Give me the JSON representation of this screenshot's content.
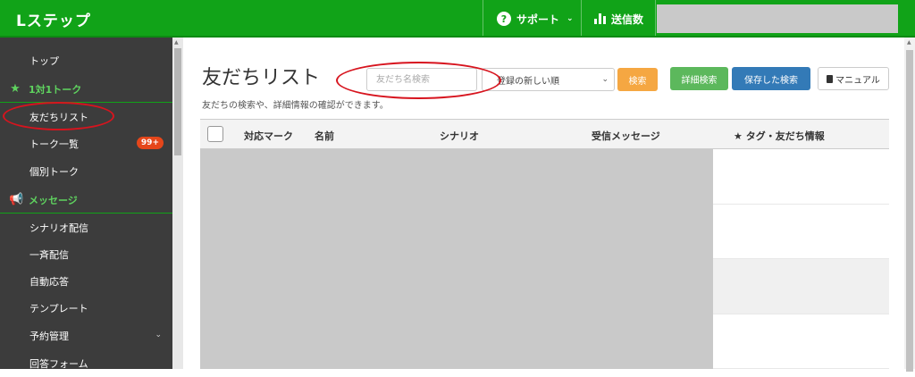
{
  "header": {
    "brand": "Lステップ",
    "support_label": "サポート",
    "sendcount_label": "送信数"
  },
  "sidebar": {
    "items": [
      {
        "label": "トップ",
        "type": "item"
      },
      {
        "label": "1対1トーク",
        "type": "section",
        "icon": "star-icon"
      },
      {
        "label": "友だちリスト",
        "type": "item",
        "annotated": true
      },
      {
        "label": "トーク一覧",
        "type": "item",
        "badge": "99+"
      },
      {
        "label": "個別トーク",
        "type": "item"
      },
      {
        "label": "メッセージ",
        "type": "section",
        "icon": "megaphone-icon"
      },
      {
        "label": "シナリオ配信",
        "type": "item"
      },
      {
        "label": "一斉配信",
        "type": "item"
      },
      {
        "label": "自動応答",
        "type": "item"
      },
      {
        "label": "テンプレート",
        "type": "item"
      },
      {
        "label": "予約管理",
        "type": "item",
        "expandable": true
      },
      {
        "label": "回答フォーム",
        "type": "item"
      }
    ]
  },
  "main": {
    "title": "友だちリスト",
    "subtitle": "友だちの検索や、詳細情報の確認ができます。",
    "search": {
      "placeholder": "友だち名検索",
      "value": ""
    },
    "sort": {
      "selected": "登録の新しい順"
    },
    "buttons": {
      "search": "検索",
      "detail_search": "詳細検索",
      "saved_search": "保存した検索",
      "manual": "マニュアル"
    },
    "table": {
      "columns": [
        "対応マーク",
        "名前",
        "シナリオ",
        "受信メッセージ",
        "★ タグ・友だち情報"
      ]
    }
  },
  "colors": {
    "header_green": "#11a318",
    "sidebar_bg": "#3c3c3c",
    "section_green": "#5fd35f",
    "badge_red": "#e5461a",
    "annotation_red": "#d7141e"
  }
}
